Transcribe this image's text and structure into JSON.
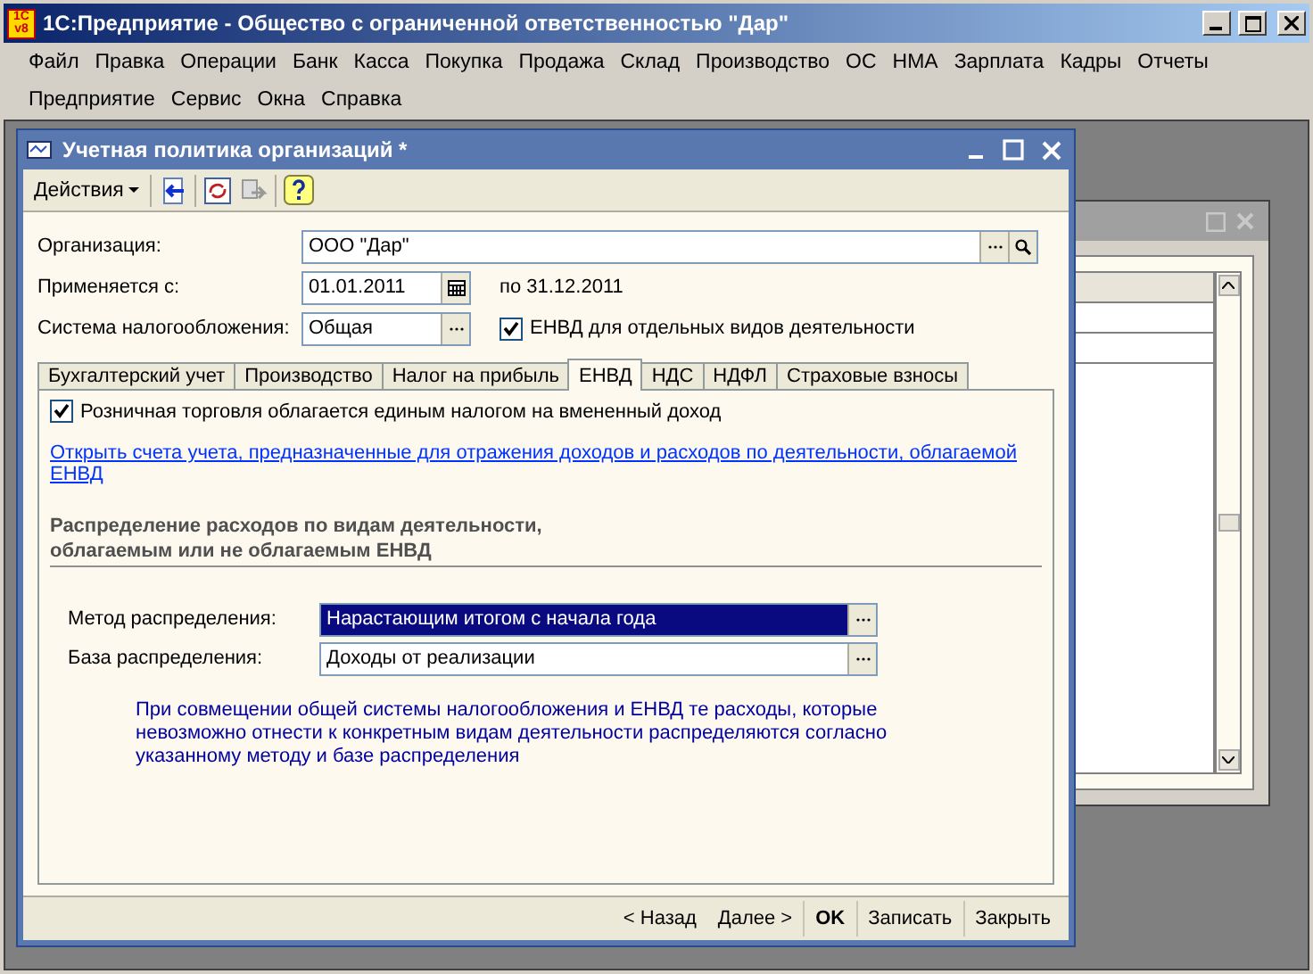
{
  "window": {
    "title": "1С:Предприятие - Общество с ограниченной ответственностью \"Дар\"",
    "logo_top": "1С",
    "logo_bottom": "v8"
  },
  "menu": [
    [
      "Файл",
      "Правка",
      "Операции",
      "Банк",
      "Касса",
      "Покупка",
      "Продажа",
      "Склад",
      "Производство",
      "ОС",
      "НМА",
      "Зарплата",
      "Кадры",
      "Отчеты"
    ],
    [
      "Предприятие",
      "Сервис",
      "Окна",
      "Справка"
    ]
  ],
  "dialog": {
    "title": "Учетная политика организаций *",
    "toolbar": {
      "actions": "Действия"
    },
    "fields": [
      {
        "label": "Организация:",
        "value": "ООО \"Дар\"",
        "kind": "ref"
      },
      {
        "label": "Применяется с:",
        "value": "01.01.2011",
        "kind": "date",
        "suffix": "по 31.12.2011"
      },
      {
        "label": "Система налогообложения:",
        "value": "Общая",
        "kind": "choice",
        "check": {
          "label": "ЕНВД для отдельных видов деятельности",
          "checked": true
        }
      }
    ],
    "tabs": [
      {
        "label": "Бухгалтерский учет",
        "selected": false
      },
      {
        "label": "Производство",
        "selected": false
      },
      {
        "label": "Налог на прибыль",
        "selected": false
      },
      {
        "label": "ЕНВД",
        "selected": true
      },
      {
        "label": "НДС",
        "selected": false
      },
      {
        "label": "НДФЛ",
        "selected": false
      },
      {
        "label": "Страховые взносы",
        "selected": false
      }
    ],
    "retail": {
      "label": "Розничная торговля облагается единым налогом на вмененный доход",
      "checked": true
    },
    "link": "Открыть счета учета, предназначенные для отражения  доходов и расходов по деятельности, облагаемой ЕНВД",
    "section": [
      "Распределение расходов по видам деятельности,",
      "облагаемым или не облагаемым ЕНВД"
    ],
    "distribution": [
      {
        "label": "Метод распределения:",
        "value": "Нарастающим итогом с начала года",
        "selected": true
      },
      {
        "label": "База распределения:",
        "value": "Доходы от реализации",
        "selected": false
      }
    ],
    "note": "При совмещении общей системы налогообложения и ЕНВД те расходы, которые невозможно отнести к конкретным видам деятельности распределяются согласно указанному методу и базе распределения",
    "footer": [
      {
        "label": "< Назад",
        "kind": "nav"
      },
      {
        "label": "Далее >",
        "kind": "nav"
      },
      {
        "label": "OK",
        "kind": "primary"
      },
      {
        "label": "Записать",
        "kind": "plain"
      },
      {
        "label": "Закрыть",
        "kind": "plain"
      }
    ]
  }
}
